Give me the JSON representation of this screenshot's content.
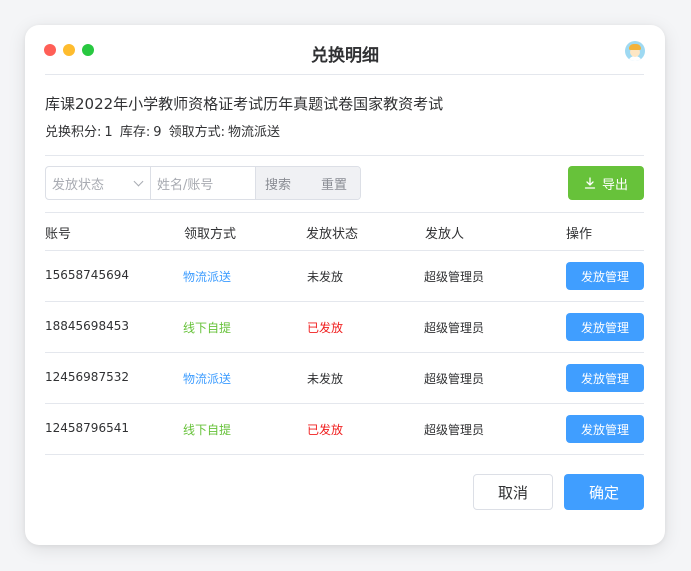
{
  "window": {
    "title": "兑换明细"
  },
  "product": {
    "name": "库课2022年小学教师资格证考试历年真题试卷国家教资考试",
    "points_label": "兑换积分:",
    "points": "1",
    "stock_label": "库存:",
    "stock": "9",
    "method_label": "领取方式:",
    "method": "物流派送"
  },
  "filter": {
    "status_placeholder": "发放状态",
    "name_placeholder": "姓名/账号",
    "search_label": "搜索",
    "reset_label": "重置"
  },
  "export_label": "导出",
  "table": {
    "headers": [
      "账号",
      "领取方式",
      "发放状态",
      "发放人",
      "操作"
    ],
    "rows": [
      {
        "account": "15658745694",
        "method": "物流派送",
        "status": "未发放",
        "issuer": "超级管理员",
        "action": "发放管理"
      },
      {
        "account": "18845698453",
        "method": "线下自提",
        "status": "已发放",
        "issuer": "超级管理员",
        "action": "发放管理"
      },
      {
        "account": "12456987532",
        "method": "物流派送",
        "status": "未发放",
        "issuer": "超级管理员",
        "action": "发放管理"
      },
      {
        "account": "12458796541",
        "method": "线下自提",
        "status": "已发放",
        "issuer": "超级管理员",
        "action": "发放管理"
      }
    ]
  },
  "footer": {
    "cancel_label": "取消",
    "confirm_label": "确定"
  },
  "colors": {
    "primary": "#409eff",
    "success": "#67c23a",
    "danger": "#f01e1e"
  }
}
